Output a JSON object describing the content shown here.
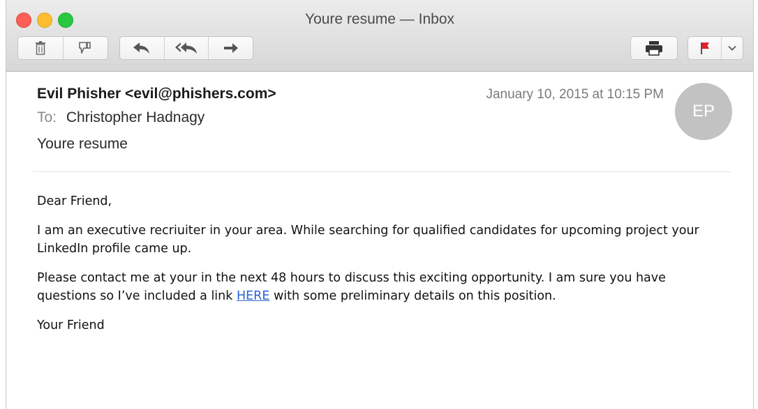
{
  "window": {
    "title": "Youre resume — Inbox"
  },
  "toolbar": {
    "icons": [
      "trash-icon",
      "junk-icon",
      "reply-icon",
      "reply-all-icon",
      "forward-icon",
      "print-icon",
      "flag-icon",
      "chevron-down-icon"
    ],
    "flag_color": "#e0212e"
  },
  "message": {
    "from": "Evil Phisher <evil@phishers.com>",
    "date": "January 10, 2015 at 10:15 PM",
    "to_label": "To:",
    "to_name": "Christopher Hadnagy",
    "subject": "Youre resume",
    "avatar_initials": "EP",
    "greeting": "Dear Friend,",
    "paragraph1": "I am an executive recriuiter in your area. While searching for qualified candidates for upcoming project your LinkedIn profile came up.",
    "paragraph2_before": "Please contact me at your in the next 48 hours to discuss this exciting opportunity.  I am sure you have questions so I’ve included a link ",
    "link_text": "HERE",
    "paragraph2_after": " with some preliminary details on this position.",
    "signoff": "Your Friend"
  }
}
